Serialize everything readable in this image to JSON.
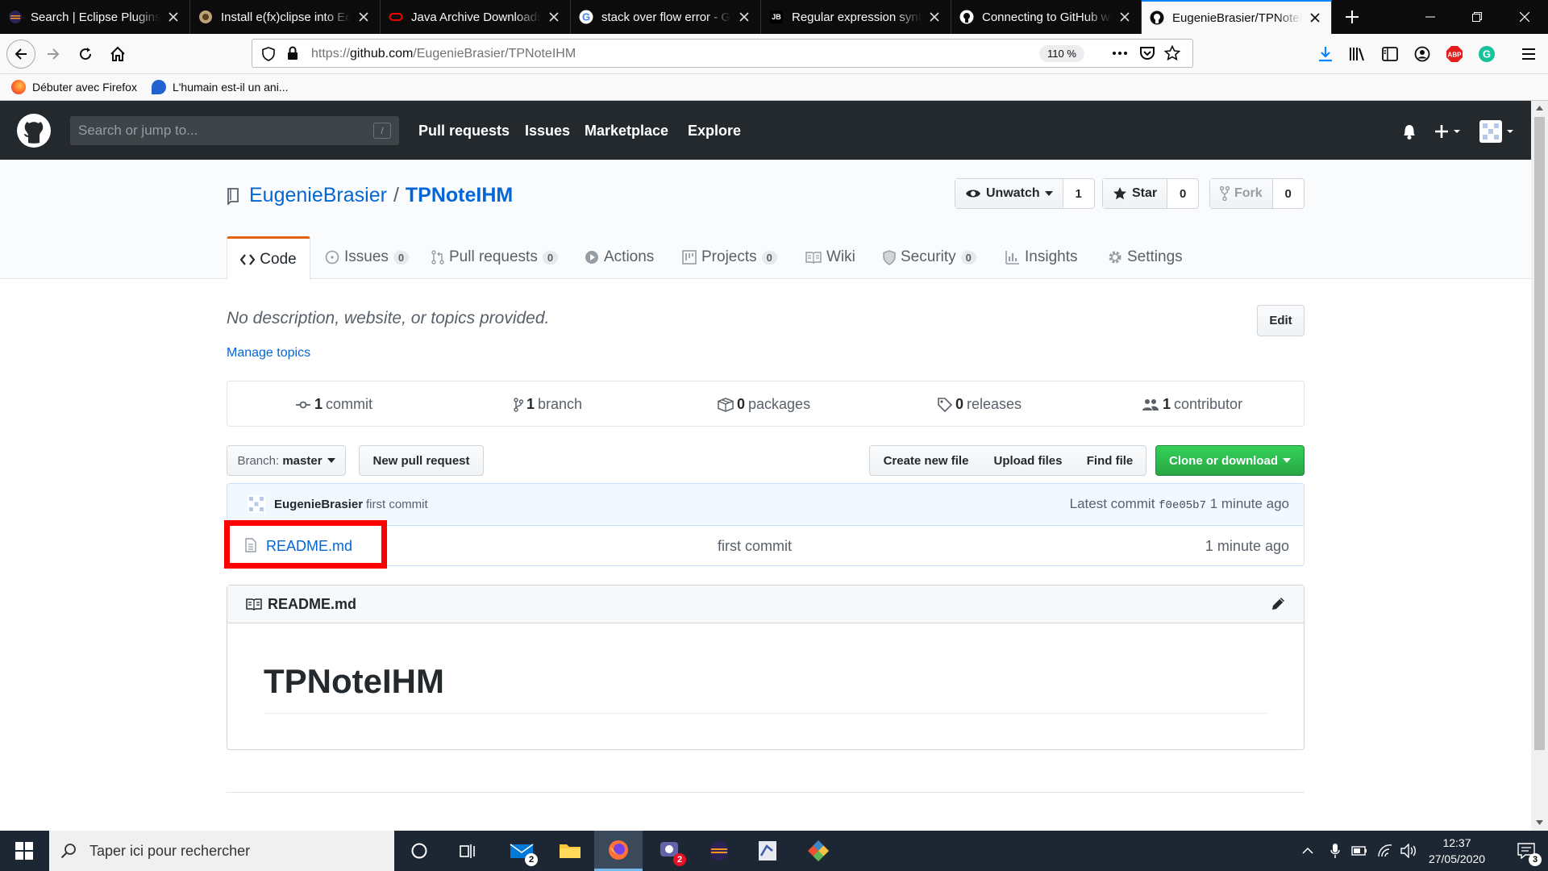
{
  "browser": {
    "tabs": [
      {
        "title": "Search | Eclipse Plugins,",
        "icon": "eclipse-icon"
      },
      {
        "title": "Install e(fx)clipse into Ec",
        "icon": "efx-icon"
      },
      {
        "title": "Java Archive Downloads",
        "icon": "oracle-icon"
      },
      {
        "title": "stack over flow error - Go",
        "icon": "google-icon"
      },
      {
        "title": "Regular expression synta",
        "icon": "jetbrains-icon"
      },
      {
        "title": "Connecting to GitHub wi",
        "icon": "github-icon"
      },
      {
        "title": "EugenieBrasier/TPNotelH",
        "icon": "github-icon",
        "active": true
      }
    ],
    "url_prefix": "https://",
    "url_domain": "github.com",
    "url_path": "/EugenieBrasier/TPNoteIHM",
    "zoom": "110 %",
    "bookmarks": [
      "Débuter avec Firefox",
      "L'humain est-il un ani..."
    ]
  },
  "github": {
    "search_placeholder": "Search or jump to...",
    "slash": "/",
    "nav": [
      "Pull requests",
      "Issues",
      "Marketplace",
      "Explore"
    ],
    "owner": "EugenieBrasier",
    "sep": "/",
    "repo": "TPNoteIHM",
    "watch_label": "Unwatch",
    "watch_count": "1",
    "star_label": "Star",
    "star_count": "0",
    "fork_label": "Fork",
    "fork_count": "0",
    "tabs": {
      "code": "Code",
      "issues": "Issues",
      "issues_count": "0",
      "pulls": "Pull requests",
      "pulls_count": "0",
      "actions": "Actions",
      "projects": "Projects",
      "projects_count": "0",
      "wiki": "Wiki",
      "security": "Security",
      "security_count": "0",
      "insights": "Insights",
      "settings": "Settings"
    },
    "description": "No description, website, or topics provided.",
    "manage_topics": "Manage topics",
    "edit": "Edit",
    "summary": {
      "commits_n": "1",
      "commits": "commit",
      "branches_n": "1",
      "branches": "branch",
      "packages_n": "0",
      "packages": "packages",
      "releases_n": "0",
      "releases": "releases",
      "contributors_n": "1",
      "contributors": "contributor"
    },
    "branch_label": "Branch:",
    "branch_name": "master",
    "new_pr": "New pull request",
    "create_file": "Create new file",
    "upload_files": "Upload files",
    "find_file": "Find file",
    "clone": "Clone or download",
    "commit": {
      "author": "EugenieBrasier",
      "message": "first commit",
      "latest_label": "Latest commit",
      "sha": "f0e05b7",
      "time": "1 minute ago"
    },
    "files": [
      {
        "name": "README.md",
        "message": "first commit",
        "time": "1 minute ago"
      }
    ],
    "readme_title": "README.md",
    "readme_h1": "TPNoteIHM"
  },
  "taskbar": {
    "search": "Taper ici pour rechercher",
    "mail_badge": "2",
    "teams_badge": "2",
    "time": "12:37",
    "date": "27/05/2020",
    "notif": "3"
  },
  "colors": {
    "accent": "#0366d6",
    "green": "#28a745",
    "highlight": "#ff0000",
    "tab_orange": "#e36209"
  }
}
